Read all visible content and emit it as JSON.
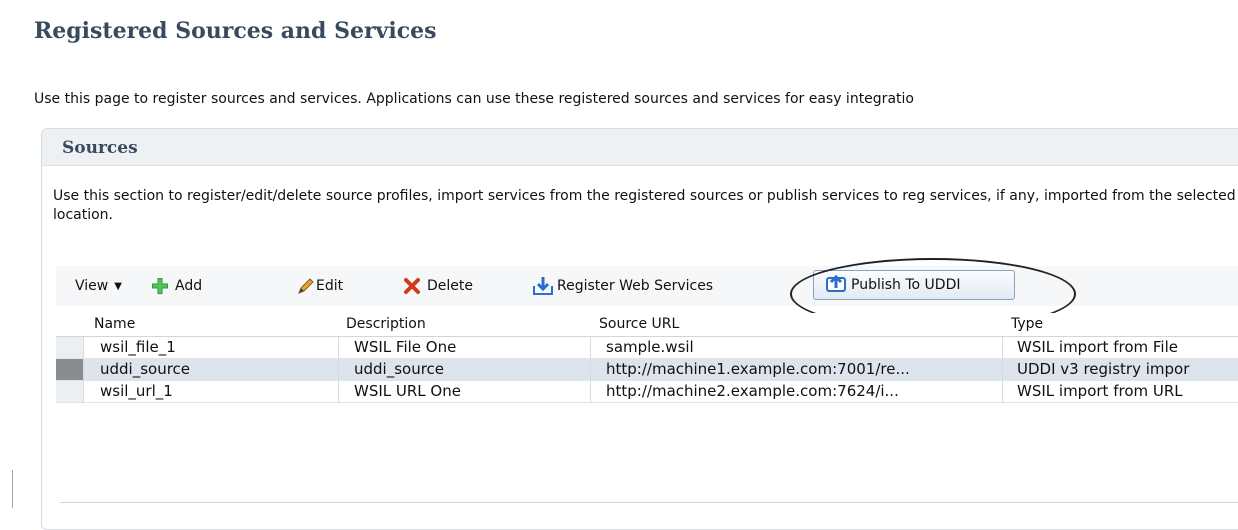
{
  "page": {
    "title": "Registered Sources and Services",
    "description": "Use this page to register sources and services. Applications can use these registered sources and services for easy integratio"
  },
  "sources": {
    "title": "Sources",
    "description": "Use this section to register/edit/delete source profiles, import services from the registered sources or publish services to reg services, if any, imported from the selected source location.",
    "toolbar": {
      "view_label": "View",
      "add_label": "Add",
      "edit_label": "Edit",
      "delete_label": "Delete",
      "register_label": "Register Web Services",
      "publish_label": "Publish To UDDI"
    },
    "columns": {
      "name": "Name",
      "description": "Description",
      "source_url": "Source URL",
      "type": "Type"
    },
    "rows": [
      {
        "name": "wsil_file_1",
        "description": "WSIL File One",
        "source_url": "sample.wsil",
        "type": "WSIL import from File",
        "selected": false
      },
      {
        "name": "uddi_source",
        "description": "uddi_source",
        "source_url": "http://machine1.example.com:7001/re...",
        "type": "UDDI v3 registry impor",
        "selected": true
      },
      {
        "name": "wsil_url_1",
        "description": "WSIL URL One",
        "source_url": "http://machine2.example.com:7624/i...",
        "type": "WSIL import from URL",
        "selected": false
      }
    ]
  },
  "icons": {
    "view_menu": "chevron-down-icon",
    "add": "plus-icon",
    "edit": "pencil-icon",
    "delete": "x-icon",
    "register": "register-arrow-icon",
    "publish": "publish-upload-icon"
  },
  "colors": {
    "title_text": "#3a4a5e",
    "add_icon": "#2f9a2f",
    "delete_icon": "#d23b1a",
    "register_icon": "#2a6fc9",
    "selected_row": "#dde4ec"
  }
}
